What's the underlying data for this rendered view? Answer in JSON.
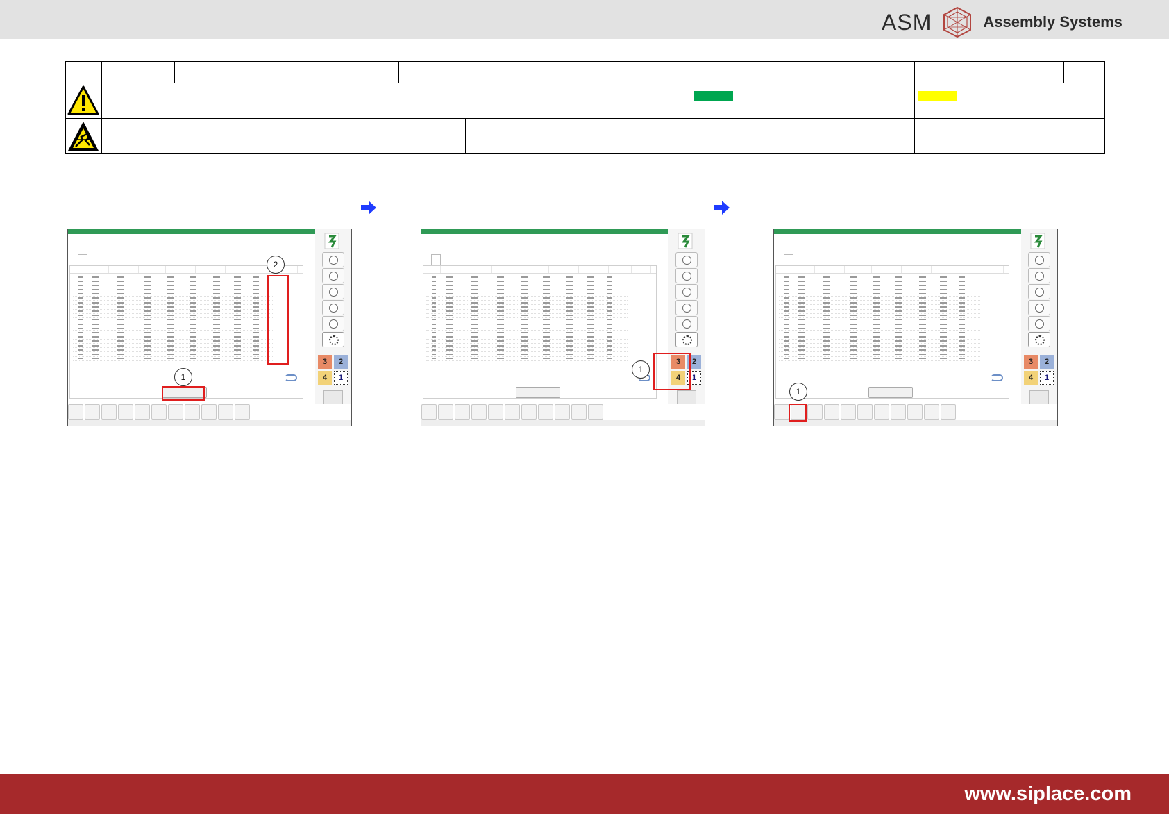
{
  "header": {
    "logo_brand": "ASM",
    "logo_text": "Assembly Systems"
  },
  "colors": {
    "header_bg": "#e2e2e2",
    "footer_bg": "#a6292b",
    "swatch_green": "#00a650",
    "swatch_yellow": "#ffff00",
    "highlight_red": "#e01e1e",
    "step_arrow": "#1f3cff"
  },
  "icons": {
    "row2": "warning-triangle-icon",
    "row3": "esd-warning-icon",
    "step_arrow": "arrow-right-icon"
  },
  "panels": [
    {
      "callouts": [
        "1",
        "2"
      ]
    },
    {
      "callouts": [
        "1"
      ]
    },
    {
      "callouts": [
        "1"
      ]
    }
  ],
  "footer": {
    "url": "www.siplace.com"
  }
}
